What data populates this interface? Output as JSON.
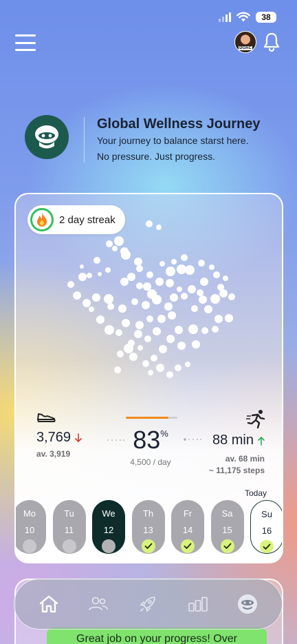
{
  "status_bar": {
    "battery": "38"
  },
  "avatar": {
    "tag": "DOAC"
  },
  "header": {
    "title": "Global Wellness Journey",
    "subtitle_line1": "Your journey to balance starst here.",
    "subtitle_line2": "No pressure. Just progress."
  },
  "streak": {
    "label": "2 day streak"
  },
  "stats": {
    "steps": {
      "value": "3,769",
      "average": "av. 3,919",
      "trend": "down",
      "trend_color": "#d9362b"
    },
    "progress": {
      "percent": "83",
      "percent_sign": "%",
      "goal": "4,500 / day",
      "fill": 0.83,
      "fill_color": "#f08a1a"
    },
    "active": {
      "value": "88 min",
      "average": "av. 68 min",
      "steps_equiv": "~ 11,175 steps",
      "trend": "up",
      "trend_color": "#2aa85c"
    }
  },
  "week": {
    "today_label": "Today",
    "days": [
      {
        "name": "Mo",
        "date": "10",
        "state": "missed"
      },
      {
        "name": "Tu",
        "date": "11",
        "state": "missed"
      },
      {
        "name": "We",
        "date": "12",
        "state": "selected"
      },
      {
        "name": "Th",
        "date": "13",
        "state": "done"
      },
      {
        "name": "Fr",
        "date": "14",
        "state": "done"
      },
      {
        "name": "Sa",
        "date": "15",
        "state": "done"
      },
      {
        "name": "Su",
        "date": "16",
        "state": "today-done"
      }
    ]
  },
  "toast": {
    "text": "Great job on your progress! Over"
  },
  "nav": {
    "items": [
      {
        "icon": "home-icon",
        "active": true
      },
      {
        "icon": "community-icon",
        "active": false
      },
      {
        "icon": "rocket-icon",
        "active": false
      },
      {
        "icon": "stats-icon",
        "active": false
      },
      {
        "icon": "profile-mascot-icon",
        "active": false
      }
    ]
  },
  "colors": {
    "brand_dark": "#1d5a4e",
    "check_bg": "#d9f37c",
    "streak_ring": "#33c05c"
  }
}
